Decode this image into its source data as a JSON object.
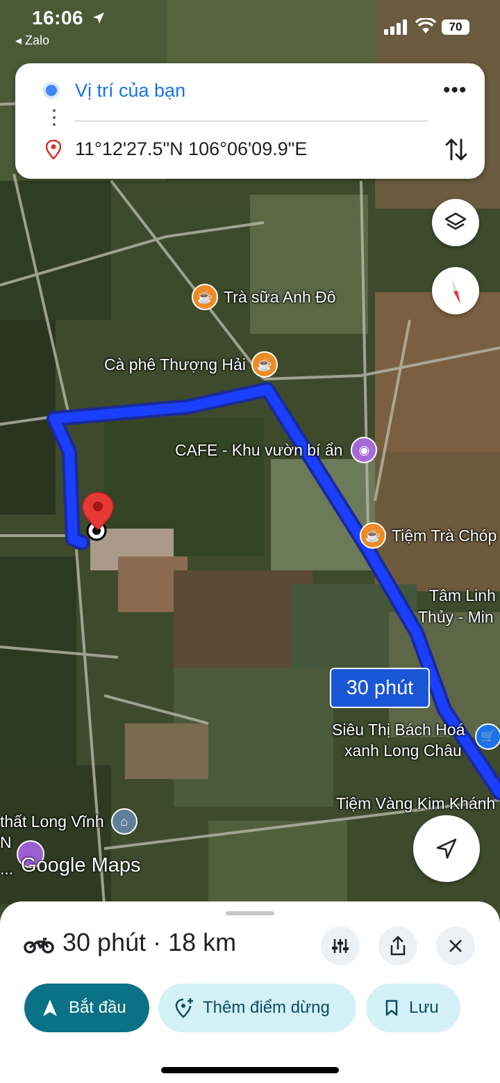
{
  "status_bar": {
    "time": "16:06",
    "back_app": "◂ Zalo",
    "battery": "70"
  },
  "directions": {
    "origin": "Vị trí của bạn",
    "destination": "11°12'27.5\"N 106°06'09.9\"E",
    "more_icon": "more-horiz-icon",
    "swap_icon": "swap-vertical-icon"
  },
  "map": {
    "pois": [
      {
        "label": "Trà sữa Anh Đô",
        "icon": "coffee-icon",
        "color": "#f08a24"
      },
      {
        "label": "Cà phê Thượng Hải",
        "icon": "coffee-icon",
        "color": "#f08a24"
      },
      {
        "label": "CAFE - Khu vườn bí ẩn",
        "icon": "camera-icon",
        "color": "#a56ad6"
      },
      {
        "label": "Tiệm Trà Chóp",
        "icon": "coffee-icon",
        "color": "#f08a24"
      },
      {
        "label": "Siêu Thị Bách Hoá",
        "icon": "cart-icon",
        "color": "#1a73e8"
      },
      {
        "label": "xanh Long Châu",
        "icon": "",
        "color": ""
      },
      {
        "label": "Tiệm Vàng Kim Khánh",
        "icon": "",
        "color": ""
      },
      {
        "label": "thất Long Vĩnh",
        "icon": "museum-icon",
        "color": "#5f7f9a"
      }
    ],
    "partial_labels": [
      "Tâm Linh",
      "Thủy - Min",
      "N",
      "..."
    ],
    "route_time": "30 phút",
    "route_color": "#1a3fff",
    "attribution": "Google Maps"
  },
  "sheet": {
    "summary": "30 phút · 18 km",
    "mode_icon": "motorcycle-icon",
    "start_label": "Bắt đầu",
    "add_stop_label": "Thêm điểm dừng",
    "save_label": "Lưu"
  }
}
